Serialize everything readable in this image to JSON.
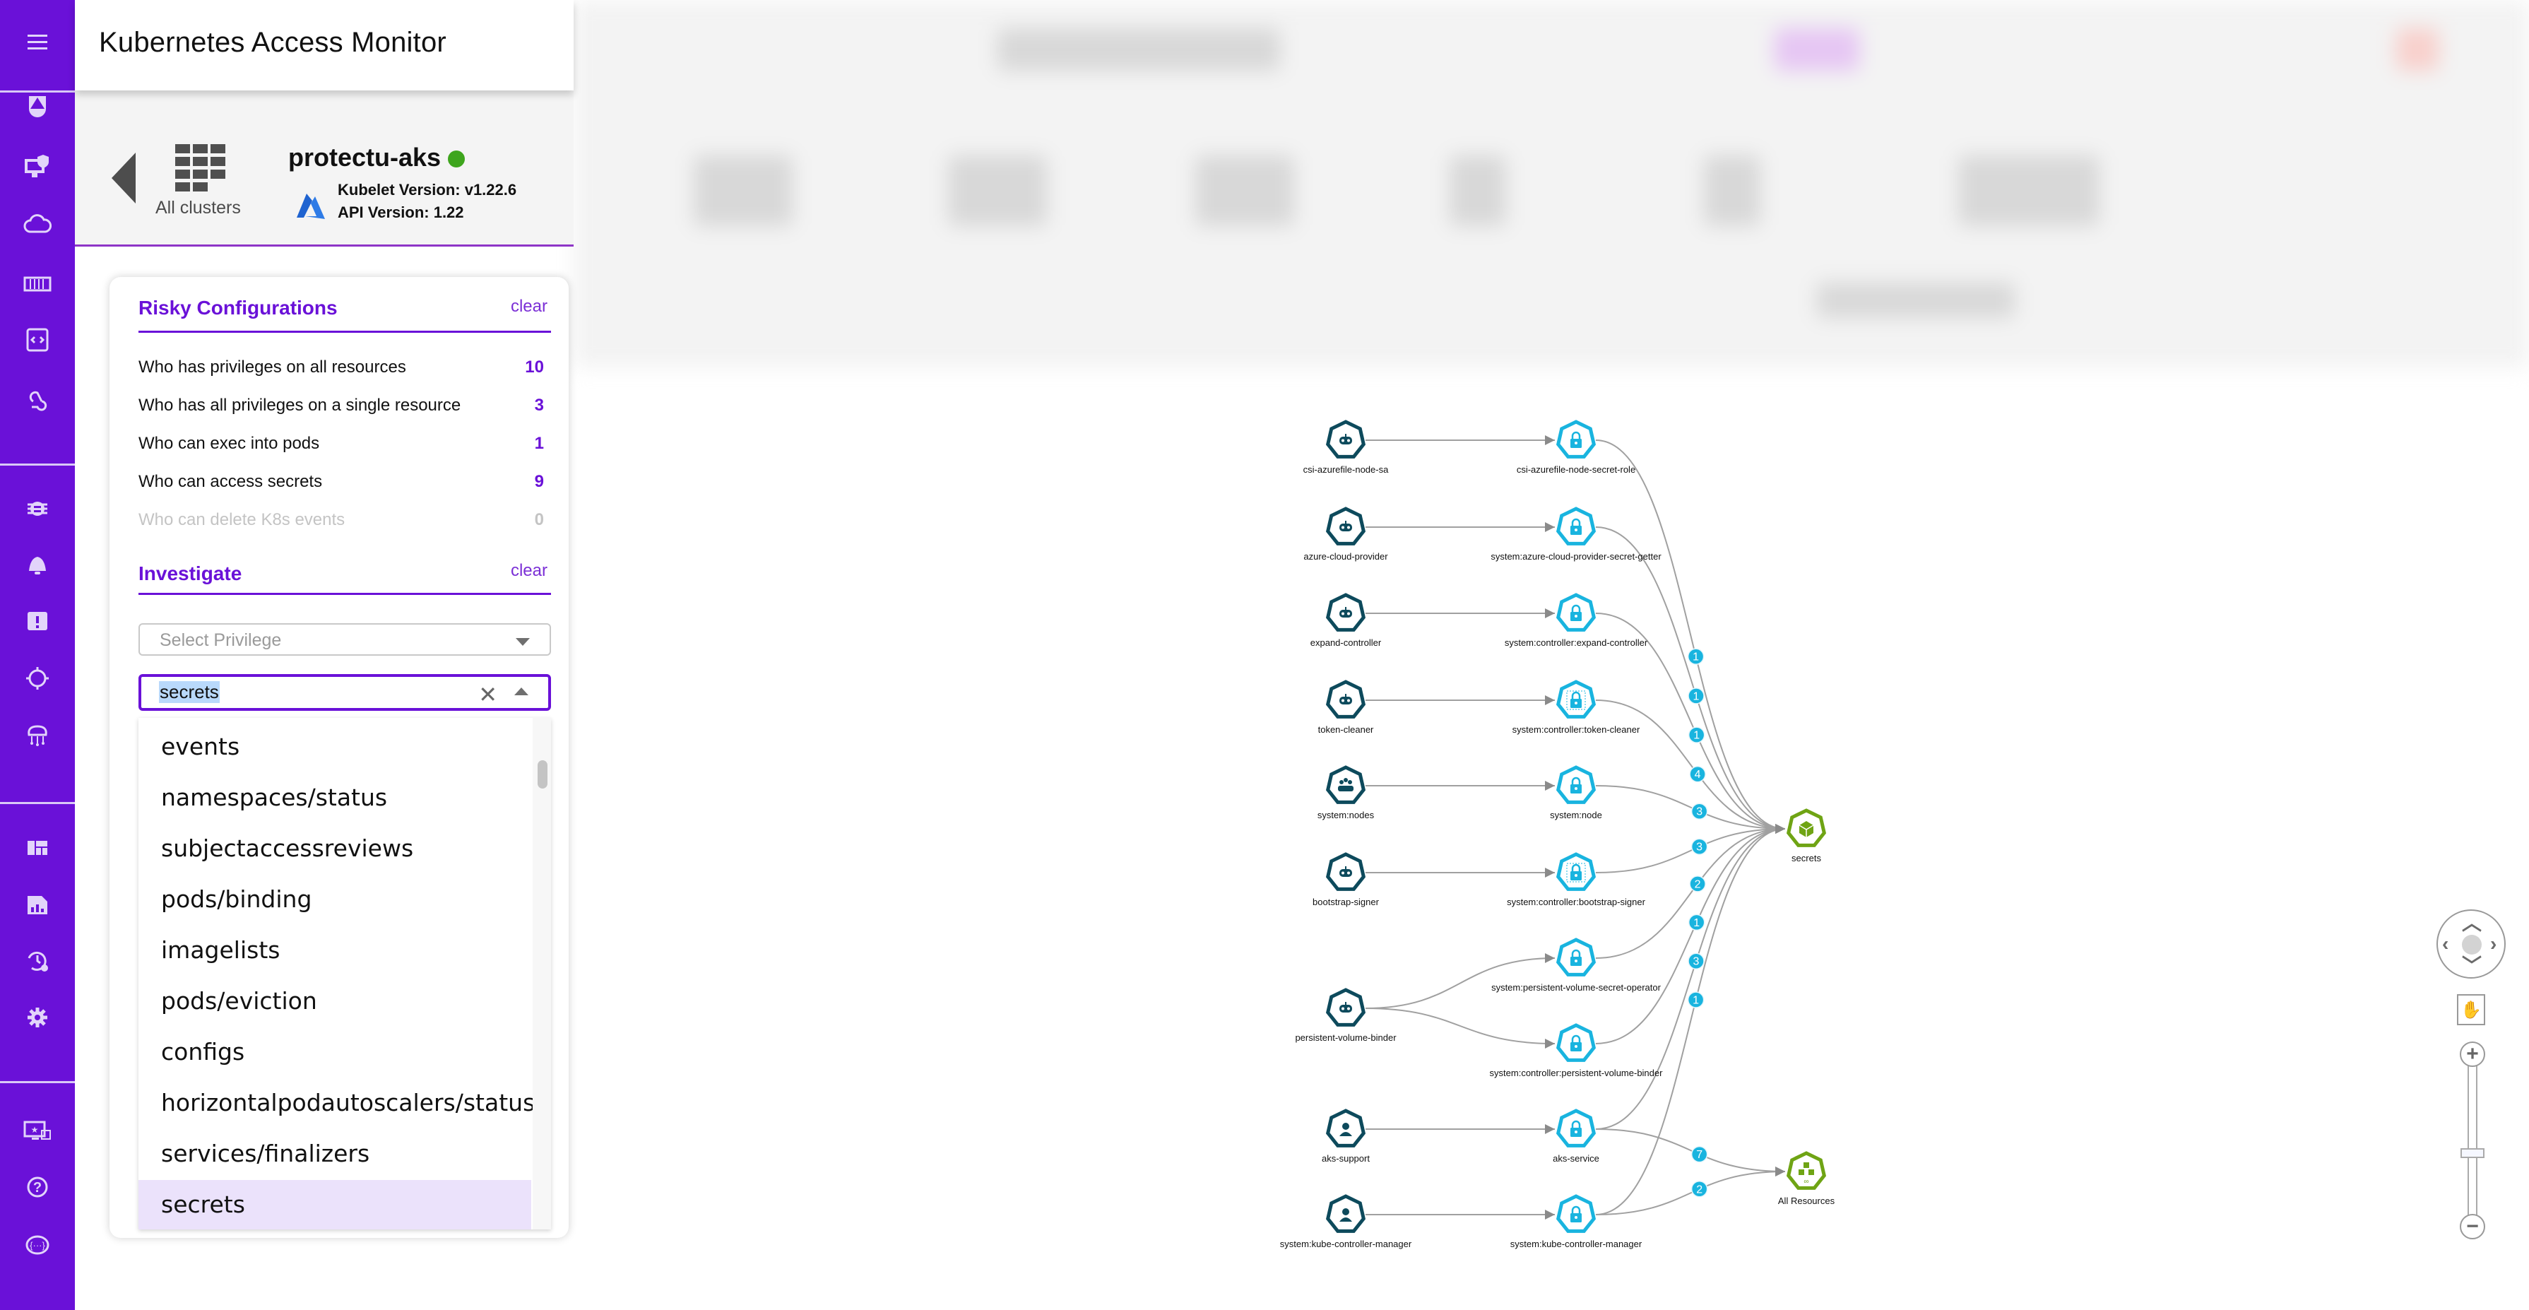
{
  "app": {
    "title": "Kubernetes Access Monitor"
  },
  "sidebar": {
    "groups": [
      [
        {
          "icon": "shield-logo-icon",
          "label": "Overview"
        },
        {
          "icon": "endpoint-security-icon",
          "label": "Endpoint Security"
        },
        {
          "icon": "cloud-icon",
          "label": "Cloud"
        },
        {
          "icon": "container-icon",
          "label": "Containers"
        },
        {
          "icon": "code-clipboard-icon",
          "label": "Code"
        },
        {
          "icon": "webhook-icon",
          "label": "Integrations"
        }
      ],
      [
        {
          "icon": "bug-icon",
          "label": "Vulnerabilities"
        },
        {
          "icon": "bell-icon",
          "label": "Alerts"
        },
        {
          "icon": "alert-clipboard-icon",
          "label": "Incidents"
        },
        {
          "icon": "crosshair-icon",
          "label": "Threat Hunting"
        },
        {
          "icon": "brain-circuit-icon",
          "label": "AI Analysis"
        }
      ],
      [
        {
          "icon": "dashboard-icon",
          "label": "Dashboard"
        },
        {
          "icon": "report-icon",
          "label": "Reports"
        },
        {
          "icon": "history-settings-icon",
          "label": "Scheduled Tasks"
        },
        {
          "icon": "gear-icon",
          "label": "Settings"
        }
      ],
      [
        {
          "icon": "monitor-star-icon",
          "label": "Devices"
        },
        {
          "icon": "help-icon",
          "label": "Help"
        },
        {
          "icon": "api-icon",
          "label": "API"
        }
      ]
    ]
  },
  "cluster": {
    "back_label": "All clusters",
    "name": "protectu-aks",
    "status": "online",
    "status_color": "#3ea51d",
    "provider_icon": "azure-icon",
    "kubelet_version": "Kubelet Version: v1.22.6",
    "api_version": "API Version: 1.22"
  },
  "risky": {
    "title": "Risky Configurations",
    "clear_label": "clear",
    "items": [
      {
        "label": "Who has privileges on all resources",
        "count": "10",
        "enabled": true
      },
      {
        "label": "Who has all privileges on a single resource",
        "count": "3",
        "enabled": true
      },
      {
        "label": "Who can exec into pods",
        "count": "1",
        "enabled": true
      },
      {
        "label": "Who can access secrets",
        "count": "9",
        "enabled": true
      },
      {
        "label": "Who can delete K8s events",
        "count": "0",
        "enabled": false
      }
    ]
  },
  "investigate": {
    "title": "Investigate",
    "clear_label": "clear",
    "privilege_placeholder": "Select Privilege",
    "resource_value": "secrets",
    "resource_options": [
      "events",
      "namespaces/status",
      "subjectaccessreviews",
      "pods/binding",
      "imagelists",
      "pods/eviction",
      "configs",
      "horizontalpodautoscalers/status",
      "services/finalizers",
      "secrets"
    ],
    "selected_option": "secrets"
  },
  "graph": {
    "colors": {
      "subject": "#0d4a5c",
      "role": "#19b4df",
      "resource": "#6fa414",
      "edge": "#a0a0a0",
      "badge": "#19b4df"
    },
    "subjects": [
      {
        "id": "s1",
        "label": "csi-azurefile-node-sa",
        "kind": "service-account"
      },
      {
        "id": "s2",
        "label": "azure-cloud-provider",
        "kind": "service-account"
      },
      {
        "id": "s3",
        "label": "expand-controller",
        "kind": "service-account"
      },
      {
        "id": "s4",
        "label": "token-cleaner",
        "kind": "service-account"
      },
      {
        "id": "s5",
        "label": "system:nodes",
        "kind": "group"
      },
      {
        "id": "s6",
        "label": "bootstrap-signer",
        "kind": "service-account"
      },
      {
        "id": "s7",
        "label": "persistent-volume-binder",
        "kind": "service-account"
      },
      {
        "id": "s8",
        "label": "aks-support",
        "kind": "user"
      },
      {
        "id": "s9",
        "label": "system:kube-controller-manager",
        "kind": "user"
      }
    ],
    "roles": [
      {
        "id": "r1",
        "label": "csi-azurefile-node-secret-role",
        "namespaced": false
      },
      {
        "id": "r2",
        "label": "system:azure-cloud-provider-secret-getter",
        "namespaced": false
      },
      {
        "id": "r3",
        "label": "system:controller:expand-controller",
        "namespaced": false
      },
      {
        "id": "r4",
        "label": "system:controller:token-cleaner",
        "namespaced": true
      },
      {
        "id": "r5",
        "label": "system:node",
        "namespaced": false
      },
      {
        "id": "r6",
        "label": "system:controller:bootstrap-signer",
        "namespaced": true
      },
      {
        "id": "r7",
        "label": "system:persistent-volume-secret-operator",
        "namespaced": false
      },
      {
        "id": "r8",
        "label": "system:controller:persistent-volume-binder",
        "namespaced": false
      },
      {
        "id": "r9",
        "label": "aks-service",
        "namespaced": false
      },
      {
        "id": "r10",
        "label": "system:kube-controller-manager",
        "namespaced": false
      }
    ],
    "resources": [
      {
        "id": "secrets",
        "label": "secrets"
      },
      {
        "id": "all",
        "label": "All Resources"
      }
    ],
    "bindings": [
      {
        "from": "s1",
        "to": "r1"
      },
      {
        "from": "s2",
        "to": "r2"
      },
      {
        "from": "s3",
        "to": "r3"
      },
      {
        "from": "s4",
        "to": "r4"
      },
      {
        "from": "s5",
        "to": "r5"
      },
      {
        "from": "s6",
        "to": "r6"
      },
      {
        "from": "s7",
        "to": "r7"
      },
      {
        "from": "s7",
        "to": "r8"
      },
      {
        "from": "s8",
        "to": "r9"
      },
      {
        "from": "s9",
        "to": "r10"
      }
    ],
    "permissions": [
      {
        "from": "r1",
        "to": "secrets",
        "count": "1"
      },
      {
        "from": "r2",
        "to": "secrets",
        "count": "1"
      },
      {
        "from": "r3",
        "to": "secrets",
        "count": "1"
      },
      {
        "from": "r4",
        "to": "secrets",
        "count": "4"
      },
      {
        "from": "r5",
        "to": "secrets",
        "count": "3"
      },
      {
        "from": "r6",
        "to": "secrets",
        "count": "3"
      },
      {
        "from": "r7",
        "to": "secrets",
        "count": "2"
      },
      {
        "from": "r8",
        "to": "secrets",
        "count": "1"
      },
      {
        "from": "r9",
        "to": "secrets",
        "count": "3"
      },
      {
        "from": "r10",
        "to": "secrets",
        "count": "1"
      },
      {
        "from": "r9",
        "to": "all",
        "count": "7"
      },
      {
        "from": "r10",
        "to": "all",
        "count": "2"
      }
    ]
  },
  "controls": {
    "pan_up": "up",
    "pan_down": "down",
    "pan_left": "left",
    "pan_right": "right",
    "zoom_in_label": "+",
    "zoom_out_label": "−",
    "zoom_level": 0.45
  }
}
